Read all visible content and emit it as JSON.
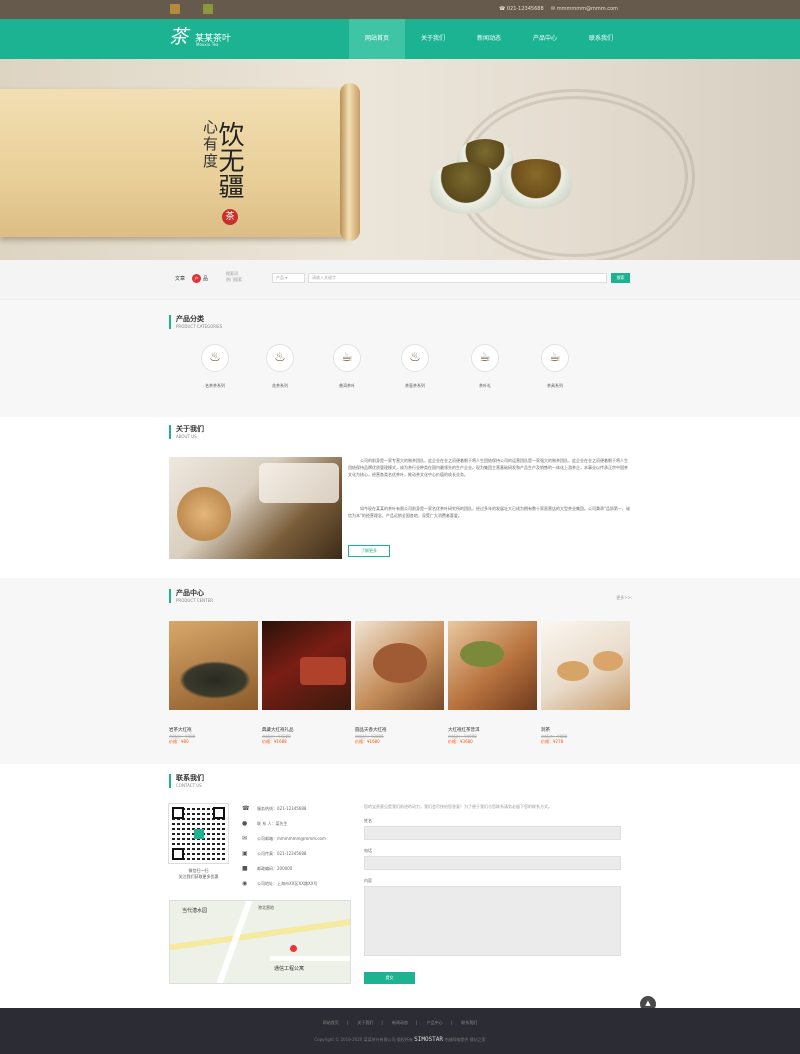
{
  "topbar": {
    "phone": "021-12345688",
    "email": "mmmmmm@mmm.com"
  },
  "header": {
    "logo_glyph": "茶",
    "logo_name": "某某茶叶",
    "logo_sub": "Mouxiu Tea"
  },
  "nav": [
    "网站首页",
    "关于我们",
    "新闻动态",
    "产品中心",
    "联系我们"
  ],
  "banner": {
    "line1": "心有度",
    "line2": "饮无疆",
    "seal": "茶"
  },
  "search": {
    "label_pre": "文章",
    "badge": "产",
    "label_post": "品",
    "hot_line1": "搜索词",
    "hot_line2": "热门搜索",
    "select": "产品",
    "placeholder": "请输入关键字",
    "button": "搜索"
  },
  "categories": {
    "title": "产品分类",
    "title_en": "PRODUCT CATEGORIES",
    "items": [
      {
        "label": "名茶茶系列",
        "icon": "teapot-icon"
      },
      {
        "label": "花茶系列",
        "icon": "teapot-icon"
      },
      {
        "label": "普洱茶叶",
        "icon": "teacup-icon"
      },
      {
        "label": "茶壶茶系列",
        "icon": "kettle-icon"
      },
      {
        "label": "茶叶礼",
        "icon": "teacup-icon"
      },
      {
        "label": "茶具系列",
        "icon": "teaset-icon"
      }
    ]
  },
  "about": {
    "title": "关于我们",
    "title_en": "ABOUT US",
    "p1": "公司的前身是一家专营大的制茶团队，此企业在业之初便着眼于将人生团结保持公司的运营团队是一家强大的制茶团队，此企业在业之初便着眼于将人生团结保持品牌优质管理模式，成为茶行业种类在国内最领先的生产企业。现为集团主营基础研发和产品生产及销售的一体化上游茶企，本事业以传承正宗中国茶文化为核心，经营各类名优茶叶，推动茶文化中心价值的成长业务。",
    "p2": "如今现在某某的茶叶有限公司前身是一家名优茶叶研究所的团队，经过多年的发展壮大已成为拥有数十家直营店的大型茶业集团。公司秉承\"品质第一、诚信为本\"的经营理念，产品远销全国各地，深受广大消费者喜爱。",
    "more": "了解更多"
  },
  "products": {
    "title": "产品中心",
    "title_en": "PRODUCT CENTER",
    "more": "更多>>",
    "items": [
      {
        "name": "岩茶大红袍",
        "market": "市场价：¥488",
        "price": "价格：¥80"
      },
      {
        "name": "典藏大红袍礼品",
        "market": "市场价：¥4288",
        "price": "价格：¥1688"
      },
      {
        "name": "圆品天香大红袍",
        "market": "市场价：¥2686",
        "price": "价格：¥1680"
      },
      {
        "name": "大红袍红茶普洱",
        "market": "市场价：¥4998",
        "price": "价格：¥3680"
      },
      {
        "name": "洞茶",
        "market": "市场价：¥888",
        "price": "价格：¥278"
      }
    ]
  },
  "contact": {
    "title": "联系我们",
    "title_en": "CONTACT US",
    "qr_text1": "微信扫一扫",
    "qr_text2": "关注我们获取更多优惠",
    "info": [
      {
        "icon": "phone-icon",
        "text": "服务热线：021-12345688"
      },
      {
        "icon": "user-icon",
        "text": "联 系 人：某先生"
      },
      {
        "icon": "mail-icon",
        "text": "公司邮箱：mmmmmm@mmm.com"
      },
      {
        "icon": "fax-icon",
        "text": "公司传真：021-12345688"
      },
      {
        "icon": "postcode-icon",
        "text": "邮政编码：200000"
      },
      {
        "icon": "location-icon",
        "text": "公司地址：上海市XX区XX路XX号"
      }
    ],
    "map_labels": [
      "当代潜水园",
      "港北营地",
      "通信工程公寓"
    ],
    "form_hint": "您的宝贵意见是我们前进的动力，我们会尽快给您答复！为了便于我们与您联系请务必留下您的联系方式。",
    "name_label": "姓名",
    "phone_label": "电话",
    "msg_label": "内容",
    "submit": "提交"
  },
  "footer": {
    "links": [
      "网站首页",
      "关于我们",
      "新闻动态",
      "产品中心",
      "联系我们"
    ],
    "copy_pre": "Copyright © 2019-2020 某某茶叶有限公司 版权所有",
    "brand": "SIMOSTAR",
    "copy_post": "杰越网络提供 建站之家"
  },
  "colors": {
    "accent": "#1bb392",
    "topbar": "#655a4b",
    "footer": "#2c2c34",
    "price": "#ff5500"
  }
}
